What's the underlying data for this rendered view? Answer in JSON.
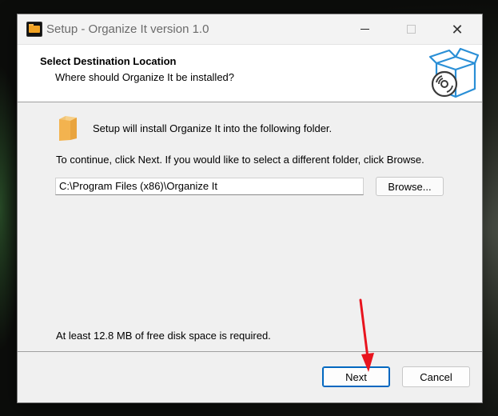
{
  "window": {
    "title": "Setup - Organize It version 1.0"
  },
  "header": {
    "title": "Select Destination Location",
    "subtitle": "Where should Organize It be installed?"
  },
  "content": {
    "install_message": "Setup will install Organize It into the following folder.",
    "continue_message": "To continue, click Next. If you would like to select a different folder, click Browse.",
    "path_value": "C:\\Program Files (x86)\\Organize It",
    "browse_label": "Browse...",
    "disk_space_message": "At least 12.8 MB of free disk space is required."
  },
  "footer": {
    "next_label": "Next",
    "cancel_label": "Cancel"
  },
  "colors": {
    "accent": "#0067c0",
    "annotation_arrow": "#e8141e"
  },
  "icons": {
    "app": "folder-app-icon",
    "header_graphic": "install-box-disc-icon",
    "destination": "folder-icon"
  }
}
